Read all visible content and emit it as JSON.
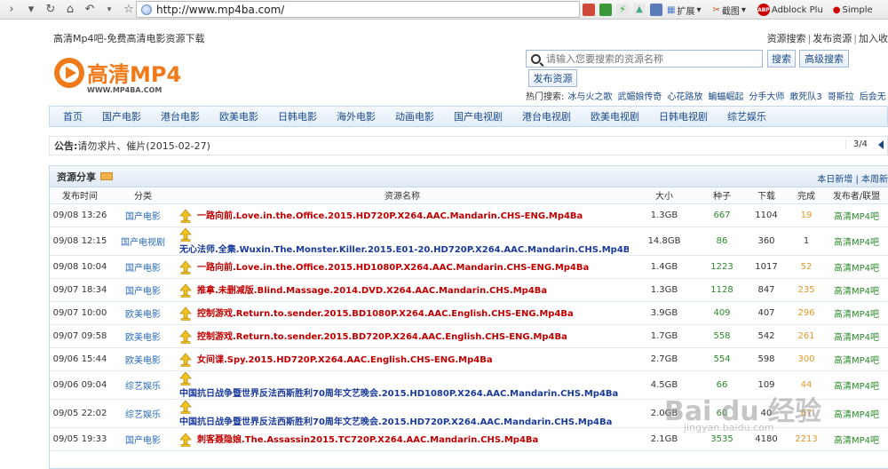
{
  "browser": {
    "url": "http://www.mp4ba.com/",
    "ext_expand": "扩展",
    "ext_screenshot": "截图",
    "ext_adblock": "Adblock Plu",
    "ext_simple": "Simple"
  },
  "header": {
    "site_title": "高清Mp4吧-免费高清电影资源下载",
    "links": [
      "资源搜索",
      "发布资源",
      "加入收"
    ],
    "logo_text": "高清MP4",
    "logo_sub": "WWW.MP4BA.COM",
    "search_placeholder": "请输入您要搜索的资源名称",
    "search_btn": "搜索",
    "adv_search_btn": "高级搜索",
    "publish_btn": "发布资源",
    "hot_label": "热门搜索:",
    "hot_items": [
      "冰与火之歌",
      "武媚娘传奇",
      "心花路放",
      "蝙蝠崛起",
      "分手大师",
      "敢死队3",
      "哥斯拉",
      "后会无"
    ]
  },
  "nav": [
    "首页",
    "国产电影",
    "港台电影",
    "欧美电影",
    "日韩电影",
    "海外电影",
    "动画电影",
    "国产电视剧",
    "港台电视剧",
    "欧美电视剧",
    "日韩电视剧",
    "综艺娱乐"
  ],
  "notice": {
    "label": "公告:",
    "text": "请勿求片、催片(2015-02-27)",
    "page": "3/4"
  },
  "panel": {
    "title": "资源分享",
    "right": "本日新增 | 本周新",
    "headers": [
      "发布时间",
      "分类",
      "资源名称",
      "大小",
      "种子",
      "下载",
      "完成",
      "发布者/联盟"
    ],
    "rows": [
      {
        "time": "09/08 13:26",
        "cat": "国产电影",
        "name": "一路向前.Love.in.the.Office.2015.HD720P.X264.AAC.Mandarin.CHS-ENG.Mp4Ba",
        "color": "red",
        "size": "1.3GB",
        "seed": "667",
        "dl": "1104",
        "done": "19",
        "pub": "高清MP4吧"
      },
      {
        "time": "09/08 12:15",
        "cat": "国产电视剧",
        "name": "无心法师.全集.Wuxin.The.Monster.Killer.2015.E01-20.HD720P.X264.AAC.Mandarin.CHS.Mp4Ba",
        "color": "blue",
        "size": "14.8GB",
        "seed": "86",
        "dl": "360",
        "done": "1",
        "pub": "高清MP4吧"
      },
      {
        "time": "09/08 10:04",
        "cat": "国产电影",
        "name": "一路向前.Love.in.the.Office.2015.HD1080P.X264.AAC.Mandarin.CHS-ENG.Mp4Ba",
        "color": "red",
        "size": "1.4GB",
        "seed": "1223",
        "dl": "1017",
        "done": "52",
        "pub": "高清MP4吧"
      },
      {
        "time": "09/07 18:34",
        "cat": "国产电影",
        "name": "推拿.未删减版.Blind.Massage.2014.DVD.X264.AAC.Mandarin.CHS.Mp4Ba",
        "color": "red",
        "size": "1.3GB",
        "seed": "1128",
        "dl": "847",
        "done": "235",
        "pub": "高清MP4吧"
      },
      {
        "time": "09/07 10:00",
        "cat": "欧美电影",
        "name": "控制游戏.Return.to.sender.2015.BD1080P.X264.AAC.English.CHS-ENG.Mp4Ba",
        "color": "red",
        "size": "3.9GB",
        "seed": "409",
        "dl": "407",
        "done": "296",
        "pub": "高清MP4吧"
      },
      {
        "time": "09/07 09:58",
        "cat": "欧美电影",
        "name": "控制游戏.Return.to.sender.2015.BD720P.X264.AAC.English.CHS-ENG.Mp4Ba",
        "color": "red",
        "size": "1.7GB",
        "seed": "558",
        "dl": "542",
        "done": "261",
        "pub": "高清MP4吧"
      },
      {
        "time": "09/06 15:44",
        "cat": "欧美电影",
        "name": "女间谍.Spy.2015.HD720P.X264.AAC.English.CHS-ENG.Mp4Ba",
        "color": "red",
        "size": "2.7GB",
        "seed": "554",
        "dl": "598",
        "done": "300",
        "pub": "高清MP4吧"
      },
      {
        "time": "09/06 09:04",
        "cat": "综艺娱乐",
        "name": "中国抗日战争暨世界反法西斯胜利70周年文艺晚会.2015.HD1080P.X264.AAC.Mandarin.CHS.Mp4Ba",
        "color": "blue",
        "size": "4.5GB",
        "seed": "66",
        "dl": "109",
        "done": "44",
        "pub": "高清MP4吧"
      },
      {
        "time": "09/05 22:02",
        "cat": "综艺娱乐",
        "name": "中国抗日战争暨世界反法西斯胜利70周年文艺晚会.2015.HD720P.X264.AAC.Mandarin.CHS.Mp4Ba",
        "color": "blue",
        "size": "2.0GB",
        "seed": "60",
        "dl": "40",
        "done": "67",
        "pub": "高清MP4吧"
      },
      {
        "time": "09/05 19:33",
        "cat": "国产电影",
        "name": "刺客聂隐娘.The.Assassin2015.TC720P.X264.AAC.Mandarin.CHS.Mp4Ba",
        "color": "red",
        "size": "2.1GB",
        "seed": "3535",
        "dl": "4180",
        "done": "2213",
        "pub": "高清MP4吧"
      }
    ]
  },
  "watermark": {
    "main": "Bai du 经验",
    "sub": "jingyan.baidu.com"
  },
  "colors": {
    "accent": "#1a4a8a",
    "red_title": "#c00000",
    "blue_title": "#1a3a9a",
    "seed": "#2a8a2a",
    "done": "#e39a28",
    "logo_orange": "#f07a1a"
  }
}
